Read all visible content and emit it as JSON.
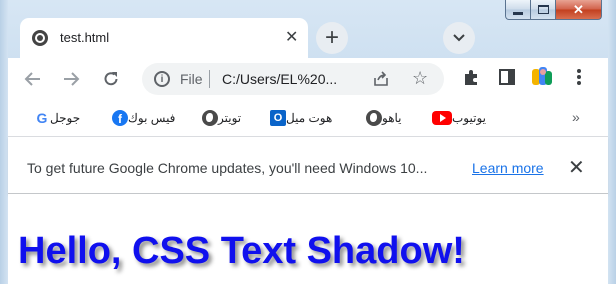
{
  "window": {
    "buttons": [
      "minimize",
      "maximize",
      "close"
    ],
    "close_glyph": "✕"
  },
  "tab": {
    "title": "test.html",
    "close_glyph": "✕",
    "favicon": "globe-icon"
  },
  "tabstrip": {
    "new_tab_glyph": "+",
    "tab_search_icon": "chevron-down-icon"
  },
  "toolbar": {
    "info_glyph": "i",
    "scheme_label": "File",
    "url": "C:/Users/EL%20...",
    "icons": [
      "back-arrow-icon",
      "forward-arrow-icon",
      "reload-icon",
      "share-icon",
      "star-icon",
      "extensions-puzzle-icon",
      "side-panel-icon",
      "profile-avatar-icon",
      "kebab-menu-icon"
    ]
  },
  "bookmarks": {
    "items": [
      {
        "label": "يوتيوب",
        "icon": "youtube-icon"
      },
      {
        "label": "ياهو",
        "icon": "globe-icon"
      },
      {
        "label": "هوت ميل",
        "icon": "outlook-icon"
      },
      {
        "label": "تويتر",
        "icon": "globe-icon"
      },
      {
        "label": "فيس بوك",
        "icon": "facebook-icon"
      },
      {
        "label": "جوجل",
        "icon": "google-icon"
      }
    ],
    "more_glyph": "»"
  },
  "infobar": {
    "message": "To get future Google Chrome updates, you'll need Windows 10...",
    "link": "Learn more",
    "close_glyph": "✕"
  },
  "page": {
    "headline": "Hello, CSS Text Shadow!"
  },
  "colors": {
    "headline": "#1010ee",
    "link": "#1a73e8",
    "close_button": "#c2401f"
  }
}
